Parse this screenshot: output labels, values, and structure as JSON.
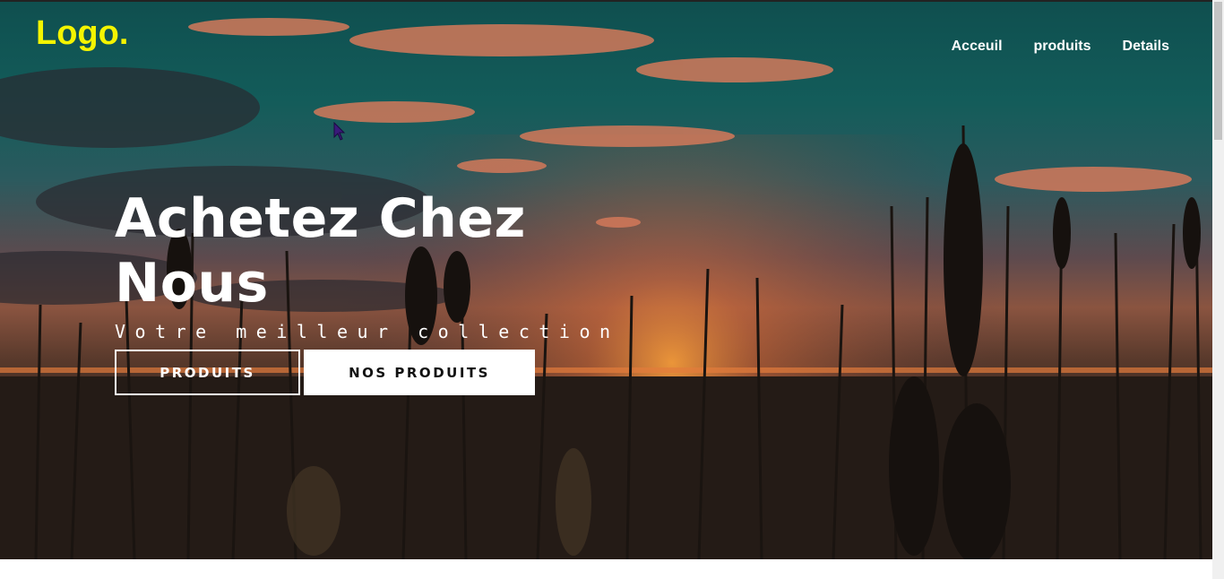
{
  "logo": {
    "text": "Logo.",
    "color": "#f4f400"
  },
  "nav": {
    "items": [
      {
        "label": "Acceuil"
      },
      {
        "label": "produits"
      },
      {
        "label": "Details"
      }
    ]
  },
  "hero": {
    "title_line1": "Achetez Chez",
    "title_line2": "Nous",
    "tagline": "Votre meilleur collection",
    "buttons": {
      "primary_label": "PRODUITS",
      "secondary_label": "NOS PRODUITS"
    }
  },
  "icons": {
    "cursor": "mouse-pointer-icon"
  },
  "colors": {
    "sky_top": "#0f4f4f",
    "sunset": "#d0713f",
    "field": "#1e1713"
  }
}
